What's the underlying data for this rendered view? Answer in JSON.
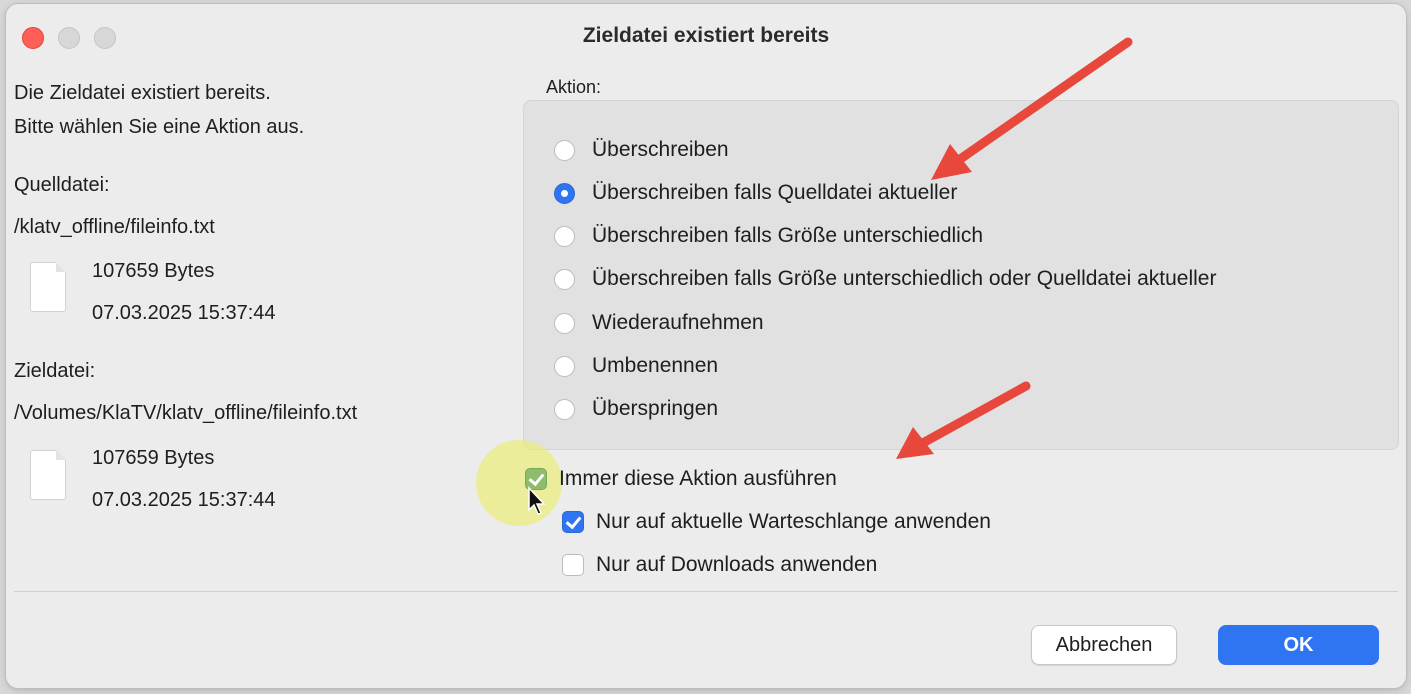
{
  "window": {
    "title": "Zieldatei existiert bereits"
  },
  "left": {
    "message_line1": "Die Zieldatei existiert bereits.",
    "message_line2": "Bitte wählen Sie eine Aktion aus.",
    "source_label": "Quelldatei:",
    "source_path": "/klatv_offline/fileinfo.txt",
    "source_size": "107659 Bytes",
    "source_date": "07.03.2025 15:37:44",
    "target_label": "Zieldatei:",
    "target_path": "/Volumes/KlaTV/klatv_offline/fileinfo.txt",
    "target_size": "107659 Bytes",
    "target_date": "07.03.2025 15:37:44"
  },
  "action": {
    "label": "Aktion:",
    "options": [
      {
        "label": "Überschreiben",
        "selected": false
      },
      {
        "label": "Überschreiben falls Quelldatei aktueller",
        "selected": true
      },
      {
        "label": "Überschreiben falls Größe unterschiedlich",
        "selected": false
      },
      {
        "label": "Überschreiben falls Größe unterschiedlich oder Quelldatei aktueller",
        "selected": false
      },
      {
        "label": "Wiederaufnehmen",
        "selected": false
      },
      {
        "label": "Umbenennen",
        "selected": false
      },
      {
        "label": "Überspringen",
        "selected": false
      }
    ]
  },
  "checkboxes": {
    "always": {
      "label": "Immer diese Aktion ausführen",
      "checked": true
    },
    "queue_only": {
      "label": "Nur auf aktuelle Warteschlange anwenden",
      "checked": true
    },
    "downloads_only": {
      "label": "Nur auf Downloads anwenden",
      "checked": false
    }
  },
  "buttons": {
    "cancel": "Abbrechen",
    "ok": "OK"
  },
  "colors": {
    "accent": "#2f74f0",
    "close": "#ff5f57",
    "annotation_arrow": "#e8473b",
    "cursor_highlight": "#ebee6e"
  },
  "icons": {
    "file": "file-icon",
    "cursor": "mouse-pointer-icon",
    "arrow": "annotation-arrow-icon"
  }
}
